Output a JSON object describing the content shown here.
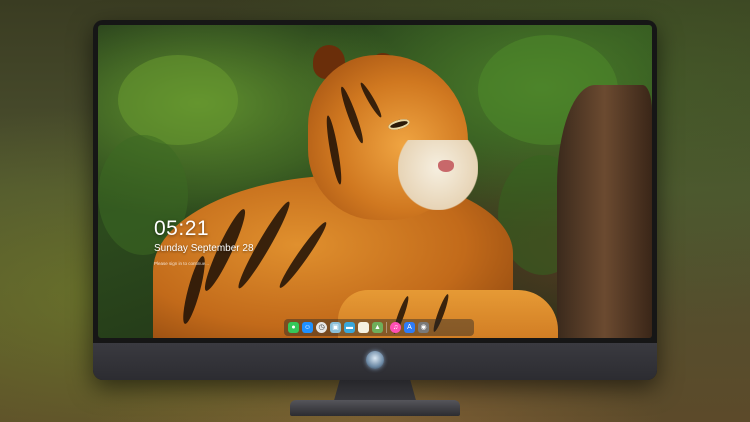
{
  "lockscreen": {
    "time": "05:21",
    "date": "Sunday September  28",
    "hint": "Please sign in to continue..."
  },
  "dock": {
    "icons": [
      "messages-icon",
      "finder-icon",
      "clock-icon",
      "photos-icon",
      "clapper-icon",
      "notes-icon",
      "maps-icon",
      "itunes-icon",
      "app-store-icon",
      "camera-icon"
    ],
    "colors": {
      "messages": "#34c759",
      "finder": "#1e90ff",
      "clock": "#e6e6e6",
      "photos": "#8bbfd8",
      "clapper": "#3aa7d9",
      "notes": "#f5f1e0",
      "maps": "#6fae5a",
      "itunes": "#ff4fb5",
      "app_store": "#2f7cf6",
      "camera": "#7a7a7a"
    }
  },
  "monitor": {
    "logo": "alien-logo-icon"
  }
}
